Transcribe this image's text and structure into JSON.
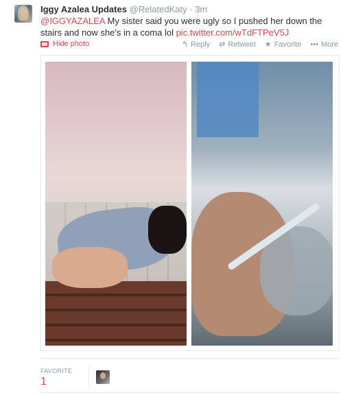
{
  "tweet": {
    "author_name": "Iggy Azalea Updates",
    "author_handle": "@RelatedKaty",
    "separator": "·",
    "time": "3m",
    "mention": "@IGGYAZALEA",
    "text": " My sister said you were ugly so I pushed her down the stairs and now she's in a coma lol ",
    "link": "pic.twitter.com/wTdFTPeV5J"
  },
  "actions": {
    "hide_photo": "Hide photo",
    "reply": "Reply",
    "retweet": "Retweet",
    "favorite": "Favorite",
    "more": "More"
  },
  "icons": {
    "reply": "reply-icon",
    "retweet": "retweet-icon",
    "favorite": "star-icon",
    "more": "more-dots-icon",
    "photo": "photo-icon"
  },
  "stats": {
    "favorite_label": "FAVORITE",
    "favorite_count": "1"
  },
  "colors": {
    "accent": "#e0474c",
    "muted": "#8899a6",
    "text": "#292f33"
  }
}
